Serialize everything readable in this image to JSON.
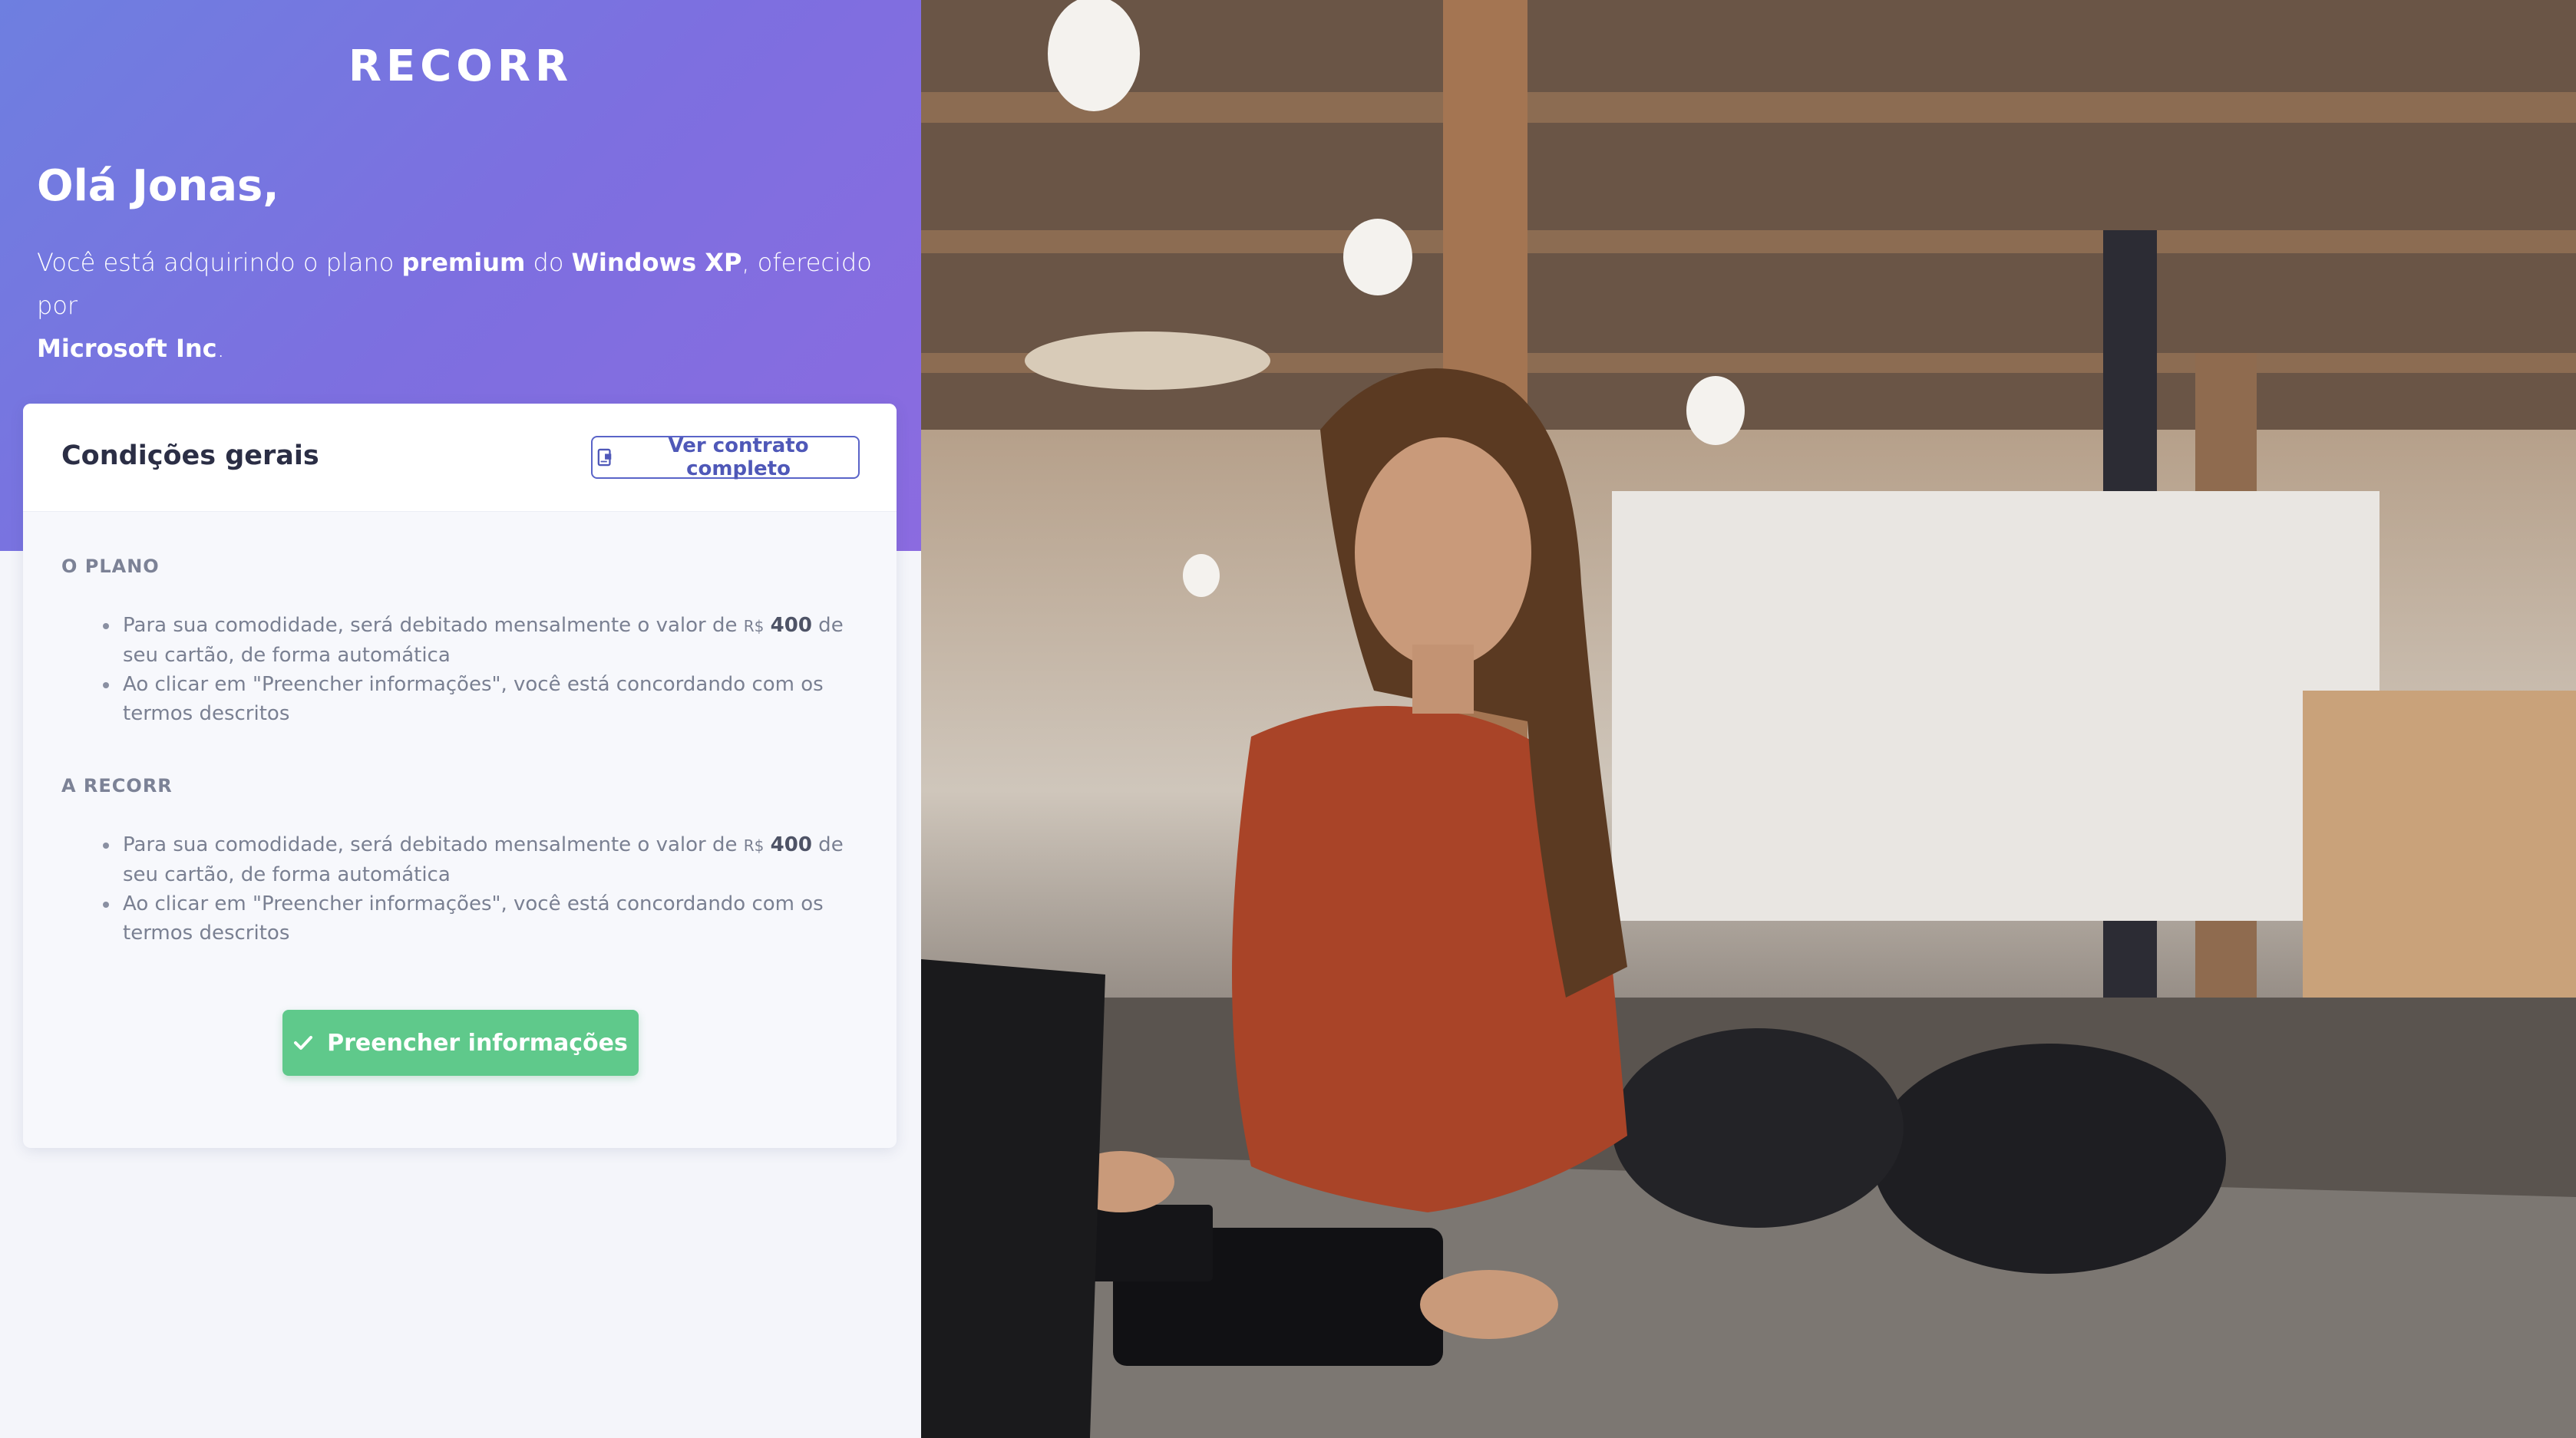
{
  "brand": {
    "logo": "RECORR"
  },
  "hero": {
    "greeting": "Olá Jonas,",
    "intro_1": "Você está adquirindo o plano ",
    "plan": "premium",
    "intro_2": " do ",
    "product": "Windows XP",
    "intro_3": ", oferecido por ",
    "vendor": "Microsoft Inc",
    "intro_4": "."
  },
  "card": {
    "title": "Condições gerais",
    "contract_button": "Ver contrato completo",
    "sections": [
      {
        "label": "O PLANO",
        "items": [
          {
            "pre": "Para sua comodidade, será debitado mensalmente o valor de ",
            "currency": "R$",
            "amount": "400",
            "post": " de seu cartão, de forma automática"
          },
          {
            "text": "Ao clicar em \"Preencher informações\", você está concordando com os termos descritos"
          }
        ]
      },
      {
        "label": "A RECORR",
        "items": [
          {
            "pre": "Para sua comodidade, será debitado mensalmente o valor de ",
            "currency": "R$",
            "amount": "400",
            "post": " de seu cartão, de forma automática"
          },
          {
            "text": "Ao clicar em \"Preencher informações\", você está concordando com os termos descritos"
          }
        ]
      }
    ],
    "submit_button": "Preencher informações"
  },
  "colors": {
    "hero_gradient_start": "#6e7fe0",
    "hero_gradient_end": "#8b6be0",
    "accent_blue": "#5a64c8",
    "submit_green": "#5fc98b"
  },
  "photo": {
    "icon": "photo-woman-paying-card"
  }
}
